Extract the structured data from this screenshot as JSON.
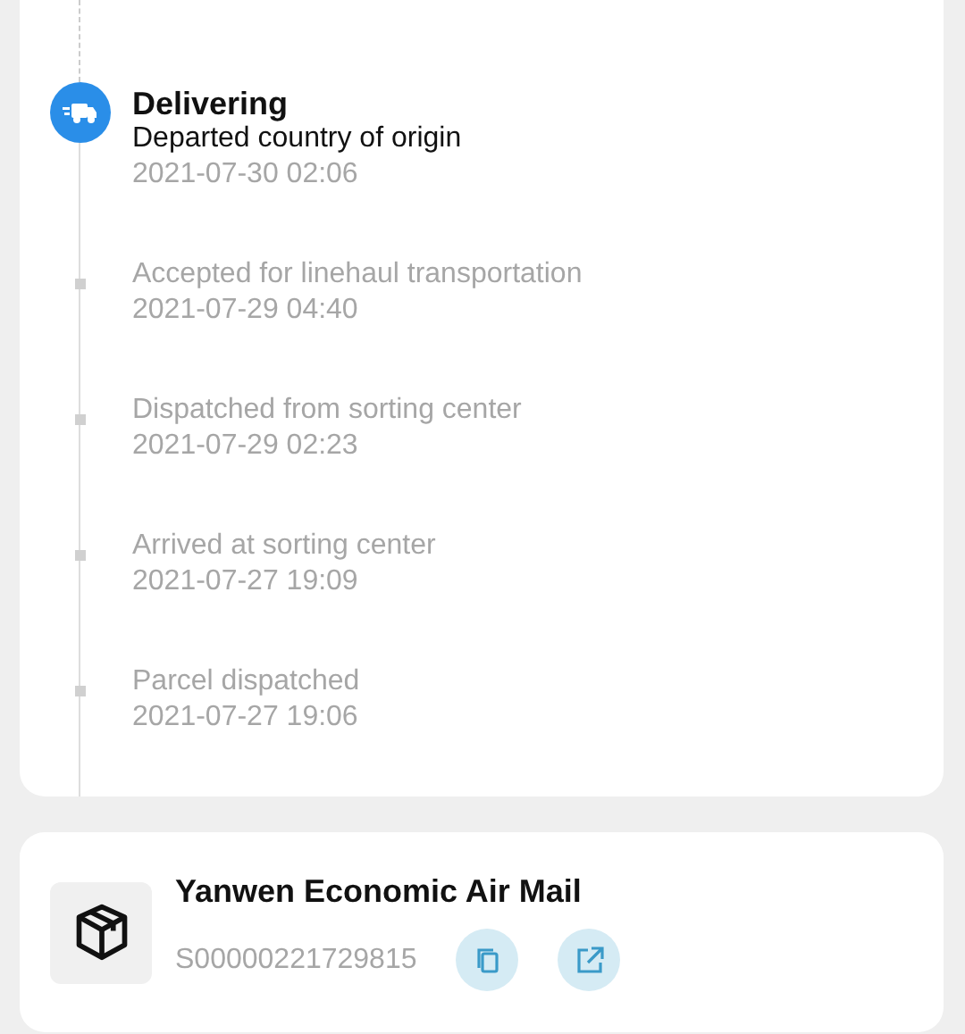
{
  "tracking": {
    "events": [
      {
        "kind": "current",
        "status": "Delivering",
        "description": "Departed country of origin",
        "time": "2021-07-30 02:06"
      },
      {
        "kind": "past",
        "description": "Accepted for linehaul transportation",
        "time": "2021-07-29 04:40"
      },
      {
        "kind": "past",
        "description": "Dispatched from sorting center",
        "time": "2021-07-29 02:23"
      },
      {
        "kind": "past",
        "description": "Arrived at sorting center",
        "time": "2021-07-27 19:09"
      },
      {
        "kind": "past",
        "description": "Parcel dispatched",
        "time": "2021-07-27 19:06"
      }
    ]
  },
  "carrier": {
    "name": "Yanwen Economic Air Mail",
    "tracking_number": "S00000221729815"
  }
}
